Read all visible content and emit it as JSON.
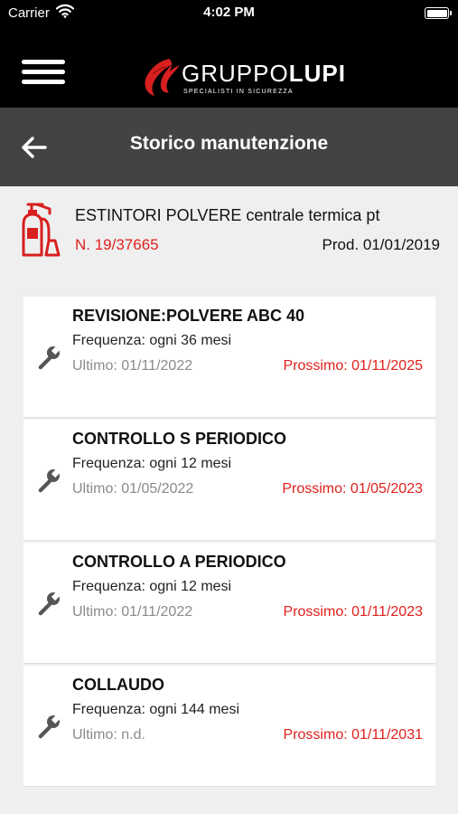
{
  "status_bar": {
    "carrier": "Carrier",
    "time": "4:02 PM"
  },
  "app_bar": {
    "logo_text_1": "GRUPPO",
    "logo_text_2": "LUPI",
    "logo_tagline": "SPECIALISTI IN SICUREZZA",
    "menu_icon": "hamburger-icon"
  },
  "nav_bar": {
    "back_icon": "back-arrow-icon",
    "title": "Storico manutenzione"
  },
  "product": {
    "icon": "fire-extinguisher-icon",
    "name": "ESTINTORI POLVERE centrale termica pt",
    "number": "N. 19/37665",
    "production": "Prod. 01/01/2019"
  },
  "maintenance": [
    {
      "title": "REVISIONE:POLVERE ABC 40",
      "frequency": "Frequenza: ogni 36 mesi",
      "last": "Ultimo: 01/11/2022",
      "next": "Prossimo: 01/11/2025"
    },
    {
      "title": "CONTROLLO S PERIODICO",
      "frequency": "Frequenza: ogni 12 mesi",
      "last": "Ultimo: 01/05/2022",
      "next": "Prossimo: 01/05/2023"
    },
    {
      "title": "CONTROLLO A PERIODICO",
      "frequency": "Frequenza: ogni 12 mesi",
      "last": "Ultimo: 01/11/2022",
      "next": "Prossimo: 01/11/2023"
    },
    {
      "title": "COLLAUDO",
      "frequency": "Frequenza: ogni 144 mesi",
      "last": "Ultimo: n.d.",
      "next": "Prossimo: 01/11/2031"
    }
  ],
  "colors": {
    "accent_red": "#e0201c",
    "header_black": "#000000",
    "nav_gray": "#434343",
    "background": "#efeff0"
  }
}
